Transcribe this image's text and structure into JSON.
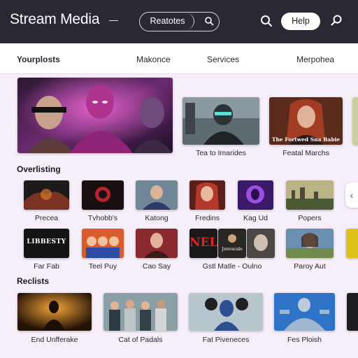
{
  "header": {
    "app_title": "Stream Media",
    "search_pill": "Reatotes",
    "help_label": "Help",
    "colors": {
      "header_bg": "#2b2833",
      "accent": "#ffffff"
    }
  },
  "nav": {
    "items": [
      {
        "label": "Yourplosts",
        "active": true
      },
      {
        "label": "Makonce"
      },
      {
        "label": "Services"
      },
      {
        "label": "Merpohea"
      }
    ]
  },
  "hero": {
    "featured": {
      "icon": "purple-hero-poster"
    },
    "cards": [
      {
        "caption": "Tea to Imarides"
      },
      {
        "caption": "Featal Marchs",
        "poster_text": "The Fortwed Sna Babie"
      }
    ]
  },
  "sections": [
    {
      "title": "Overlisting",
      "row1": [
        {
          "caption": "Precea"
        },
        {
          "caption": "Tvhobb's"
        },
        {
          "caption": "Katong"
        },
        {
          "caption": "Fredins"
        },
        {
          "caption": "Kag Ud"
        },
        {
          "caption": "Popers"
        }
      ],
      "row2": [
        {
          "caption": "Far Fab",
          "poster_text": "LIBBESTY"
        },
        {
          "caption": "Teel Puy"
        },
        {
          "caption": "Cao Say"
        },
        {
          "caption": "Gstl Matle - Oulno",
          "poster_text": "NEL",
          "poster_text_2": "Jonvacale"
        },
        {
          "caption": "Paroy Aut"
        }
      ]
    },
    {
      "title": "Reclists",
      "row1": [
        {
          "caption": "End Unfferake"
        },
        {
          "caption": "Cat of Padals"
        },
        {
          "caption": "Fat Piveneces"
        },
        {
          "caption": "Fes Ploish"
        }
      ]
    }
  ]
}
